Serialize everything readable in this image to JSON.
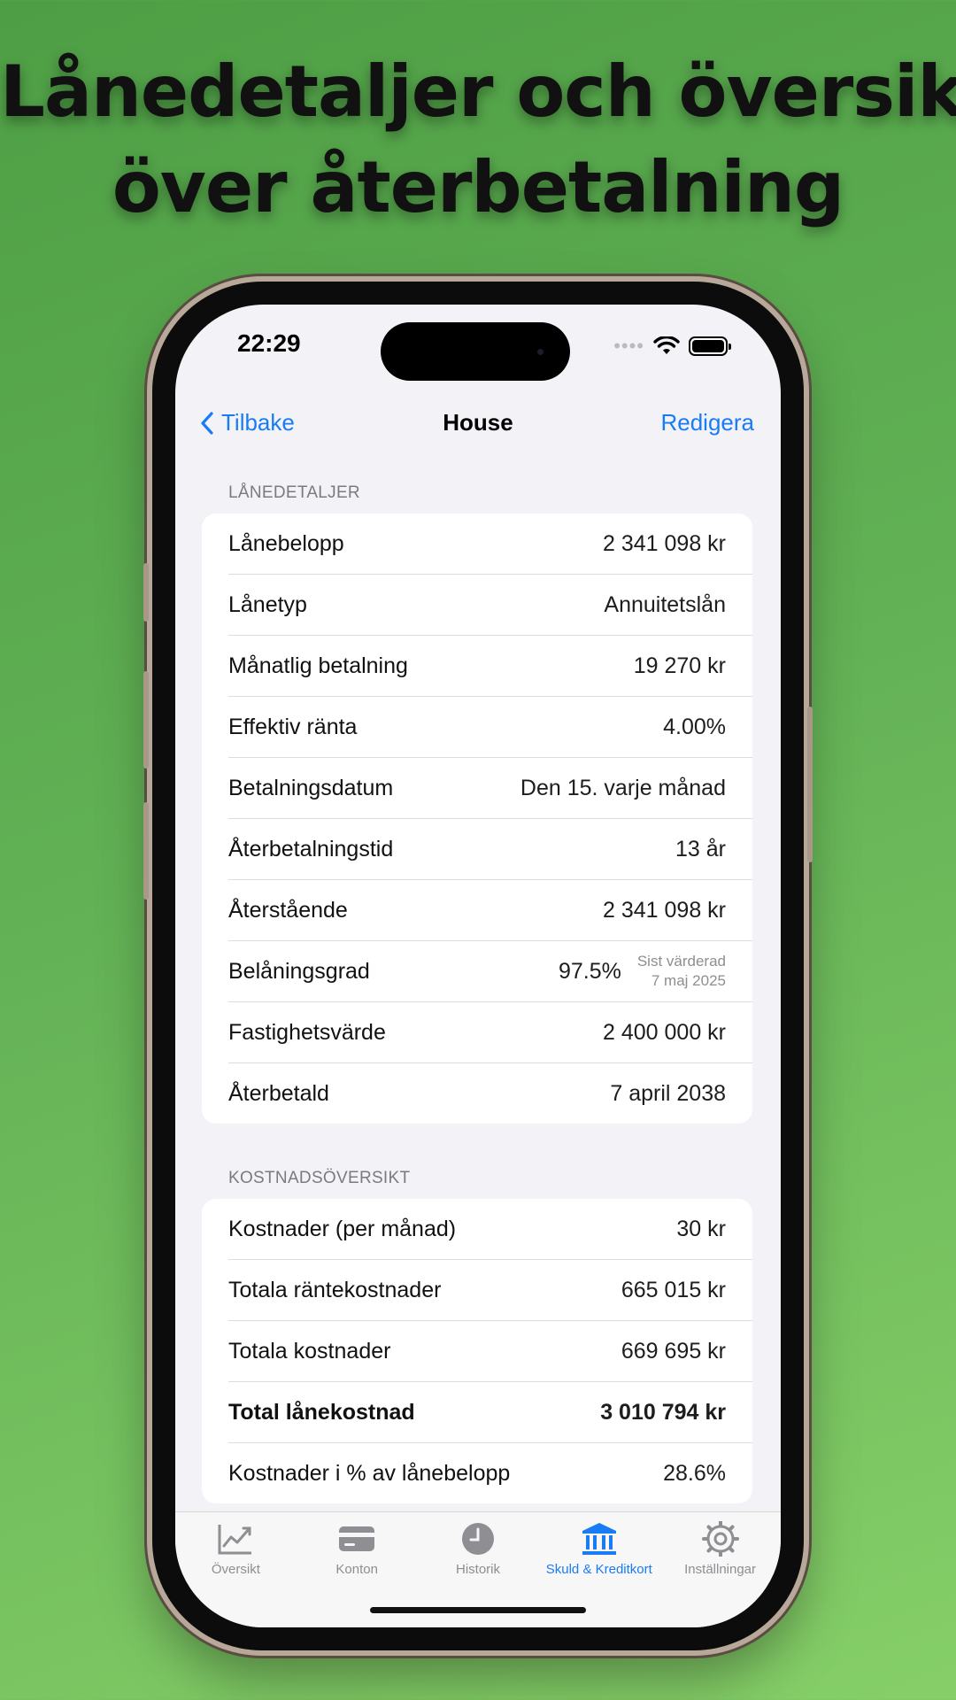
{
  "headline": {
    "line1": "Lånedetaljer och översikt",
    "line2": "över återbetalning"
  },
  "status_bar": {
    "time": "22:29"
  },
  "nav": {
    "back_label": "Tilbake",
    "title": "House",
    "edit_label": "Redigera"
  },
  "loan_details": {
    "header": "LÅNEDETALJER",
    "rows": [
      {
        "label": "Lånebelopp",
        "value": "2 341 098 kr"
      },
      {
        "label": "Lånetyp",
        "value": "Annuitetslån"
      },
      {
        "label": "Månatlig betalning",
        "value": "19 270 kr"
      },
      {
        "label": "Effektiv ränta",
        "value": "4.00%"
      },
      {
        "label": "Betalningsdatum",
        "value": "Den 15. varje månad"
      },
      {
        "label": "Återbetalningstid",
        "value": "13 år"
      },
      {
        "label": "Återstående",
        "value": "2 341 098 kr"
      },
      {
        "label": "Belåningsgrad",
        "value": "97.5%",
        "note_line1": "Sist värderad",
        "note_line2": "7 maj 2025"
      },
      {
        "label": "Fastighetsvärde",
        "value": "2 400 000 kr"
      },
      {
        "label": "Återbetald",
        "value": "7 april 2038"
      }
    ]
  },
  "cost_overview": {
    "header": "KOSTNADSÖVERSIKT",
    "rows": [
      {
        "label": "Kostnader (per månad)",
        "value": "30 kr"
      },
      {
        "label": "Totala räntekostnader",
        "value": "665 015 kr"
      },
      {
        "label": "Totala kostnader",
        "value": "669 695 kr"
      },
      {
        "label": "Total lånekostnad",
        "value": "3 010 794 kr"
      },
      {
        "label": "Kostnader i % av lånebelopp",
        "value": "28.6%"
      }
    ]
  },
  "tab_bar": {
    "tabs": [
      {
        "label": "Översikt",
        "icon": "chart-line-icon"
      },
      {
        "label": "Konton",
        "icon": "credit-card-icon"
      },
      {
        "label": "Historik",
        "icon": "clock-icon"
      },
      {
        "label": "Skuld & Kreditkort",
        "icon": "bank-icon",
        "active": true
      },
      {
        "label": "Inställningar",
        "icon": "gear-icon"
      }
    ]
  },
  "colors": {
    "accent": "#1a7cf5",
    "background_green": "#62b155",
    "screen_bg": "#f2f2f7"
  }
}
